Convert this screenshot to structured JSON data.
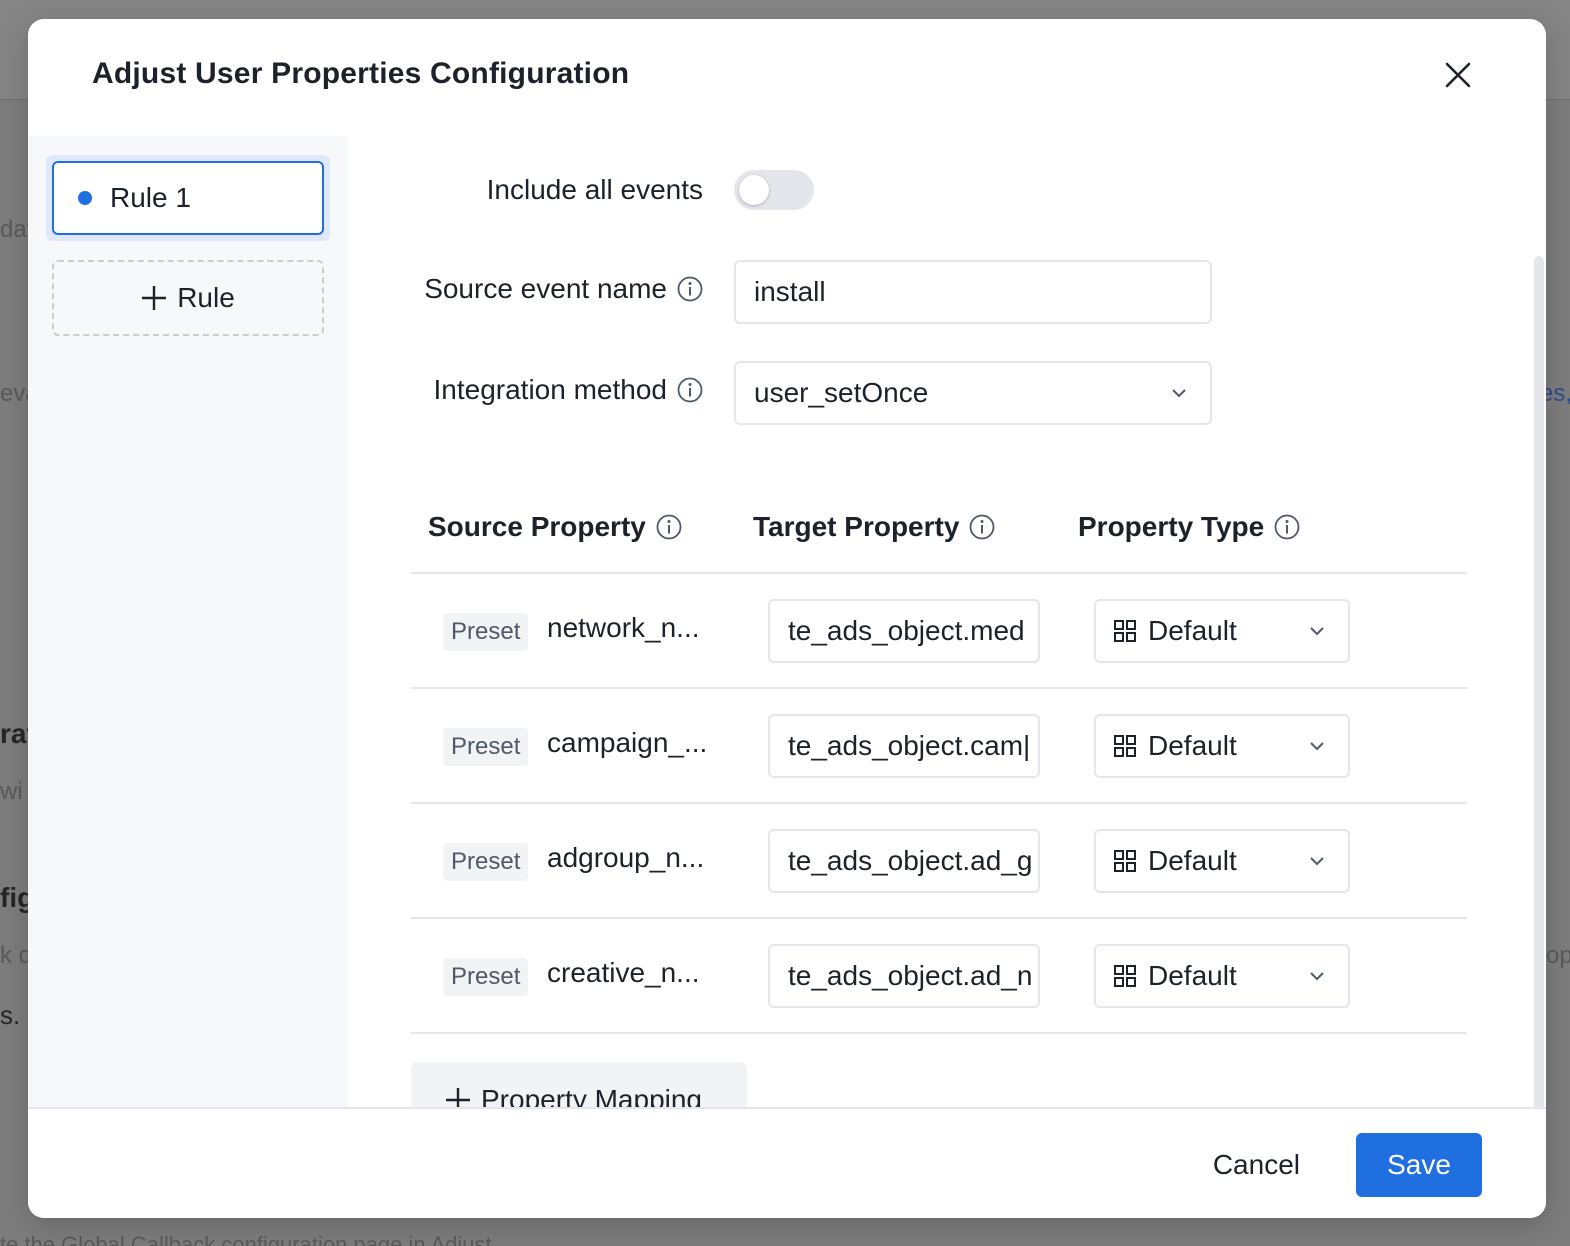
{
  "background": {
    "fragments": [
      "dat",
      "eva",
      "rat",
      "wi",
      "fig",
      "k d",
      "s.",
      "es,",
      "op",
      "te the Global Callback configuration page in Adjust"
    ]
  },
  "modal": {
    "title": "Adjust User Properties Configuration",
    "close_icon": "close-icon"
  },
  "sidebar": {
    "rules": [
      {
        "label": "Rule 1",
        "active": true
      }
    ],
    "add_rule_label": "Rule"
  },
  "form": {
    "include_all_events_label": "Include all events",
    "include_all_events_on": false,
    "source_event_label": "Source event name",
    "source_event_value": "install",
    "integration_method_label": "Integration method",
    "integration_method_value": "user_setOnce"
  },
  "table": {
    "headers": {
      "source": "Source Property",
      "target": "Target Property",
      "type": "Property Type"
    },
    "rows": [
      {
        "tag": "Preset",
        "source": "network_n...",
        "target": "te_ads_object.med",
        "type": "Default"
      },
      {
        "tag": "Preset",
        "source": "campaign_...",
        "target": "te_ads_object.cam|",
        "type": "Default"
      },
      {
        "tag": "Preset",
        "source": "adgroup_n...",
        "target": "te_ads_object.ad_g",
        "type": "Default"
      },
      {
        "tag": "Preset",
        "source": "creative_n...",
        "target": "te_ads_object.ad_n",
        "type": "Default"
      }
    ],
    "add_mapping_label": "Property Mapping"
  },
  "footer": {
    "cancel_label": "Cancel",
    "save_label": "Save"
  },
  "colors": {
    "primary": "#1f6fe0",
    "border": "#e5e6eb",
    "sidebar_bg": "#f7f8fa"
  }
}
